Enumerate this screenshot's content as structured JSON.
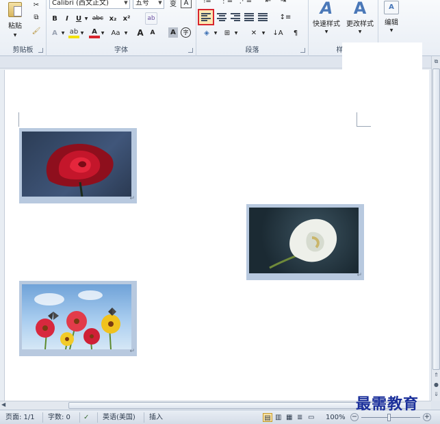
{
  "ribbon": {
    "clipboard": {
      "paste_label": "粘贴",
      "group_label": "剪贴板"
    },
    "font": {
      "font_name": "Calibri (西文正文)",
      "font_size": "五号",
      "bold": "B",
      "italic": "I",
      "underline": "U",
      "strikethrough": "abc",
      "subscript": "x₂",
      "superscript": "x²",
      "font_color": "A",
      "change_case": "Aa",
      "grow_font": "A",
      "shrink_font": "A",
      "char_shading": "A",
      "enclose": "字",
      "group_label": "字体"
    },
    "paragraph": {
      "group_label": "段落"
    },
    "styles": {
      "quick_styles_label": "快速样式",
      "change_styles_label": "更改样式",
      "group_label": "样式"
    },
    "editing": {
      "label": "编辑"
    }
  },
  "document": {
    "images": [
      {
        "name": "red-rose-image"
      },
      {
        "name": "calla-lily-image"
      },
      {
        "name": "gerbera-daisies-image"
      }
    ]
  },
  "statusbar": {
    "page": "页面: 1/1",
    "words": "字数: 0",
    "language": "英语(美国)",
    "mode": "插入",
    "zoom": "100%",
    "zoom_out": "−",
    "zoom_in": "+"
  },
  "watermark": "最需教育",
  "colors": {
    "active_align_border": "#d8262e",
    "image_frame": "#b8c9df",
    "watermark": "#1a2f9a"
  }
}
